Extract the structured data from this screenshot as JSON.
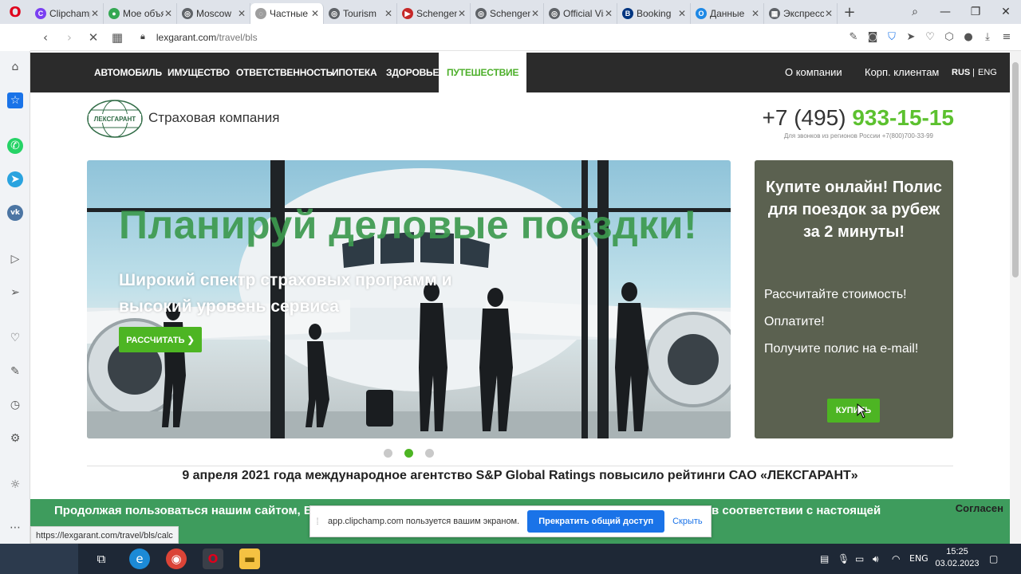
{
  "browser": {
    "tabs": [
      {
        "label": "Clipchamp",
        "color": "#7a3ff2",
        "glyph": "C"
      },
      {
        "label": "Мое объявление",
        "color": "#34a853",
        "glyph": "●"
      },
      {
        "label": "Moscow",
        "color": "#5f6368",
        "glyph": "◎"
      },
      {
        "label": "Частные",
        "color": "#9e9e9e",
        "glyph": "◌"
      },
      {
        "label": "Tourism",
        "color": "#5f6368",
        "glyph": "◎"
      },
      {
        "label": "Schengen",
        "color": "#c62828",
        "glyph": "▶"
      },
      {
        "label": "Schengen",
        "color": "#5f6368",
        "glyph": "◎"
      },
      {
        "label": "Official Visa",
        "color": "#5f6368",
        "glyph": "◎"
      },
      {
        "label": "Booking",
        "color": "#003580",
        "glyph": "B"
      },
      {
        "label": "Данные",
        "color": "#1e88e5",
        "glyph": "O"
      },
      {
        "label": "Экспресс",
        "color": "#5f6368",
        "glyph": "▦"
      }
    ],
    "active_tab_index": 3,
    "url_domain": "lexgarant.com",
    "url_path": "/travel/bls",
    "status_url": "https://lexgarant.com/travel/bls/calc"
  },
  "site": {
    "nav": [
      "АВТОМОБИЛЬ",
      "ИМУЩЕСТВО",
      "ОТВЕТСТВЕННОСТЬ",
      "ИПОТЕКА",
      "ЗДОРОВЬЕ",
      "ПУТЕШЕСТВИЕ"
    ],
    "nav_right": [
      "О компании",
      "Корп. клиентам"
    ],
    "lang_active": "RUS",
    "lang_sep": "|",
    "lang_other": "ENG",
    "logo_text": "ЛЕКСГАРАНТ",
    "company": "Страховая компания",
    "phone_prefix": "+7 (495) ",
    "phone_main": "933-15-15",
    "phone_note": "Для звонков из регионов России +7(800)700-33-99",
    "hero_title": "Планируй деловые поездки!",
    "hero_sub": "Широкий спектр страховых программ и высокий уровень сервиса",
    "hero_button": "РАССЧИТАТЬ ❯",
    "promo_title": "Купите онлайн! Полис для поездок за рубеж за 2 минуты!",
    "promo_steps": [
      "Рассчитайте стоимость!",
      "Оплатите!",
      "Получите полис на e-mail!"
    ],
    "promo_button": "КУПИТЬ",
    "news": "9 апреля 2021 года международное агентство  S&P Global Ratings повысило рейтинги САО «ЛЕКСГАРАНТ»",
    "cookie_text_left": "Продолжая пользоваться нашим сайтом, Вы",
    "cookie_text_right": "в соответствии с настоящей",
    "cookie_agree": "Согласен"
  },
  "share_bar": {
    "text": "app.clipchamp.com пользуется вашим экраном.",
    "stop": "Прекратить общий доступ",
    "hide": "Скрыть"
  },
  "taskbar": {
    "lang": "ENG",
    "time": "15:25",
    "date": "03.02.2023"
  },
  "colors": {
    "accent_green": "#4db523",
    "nav_dark": "#2b2b2b",
    "promo_bg": "#5b6150",
    "cookie_bg": "#3e9c5d"
  }
}
